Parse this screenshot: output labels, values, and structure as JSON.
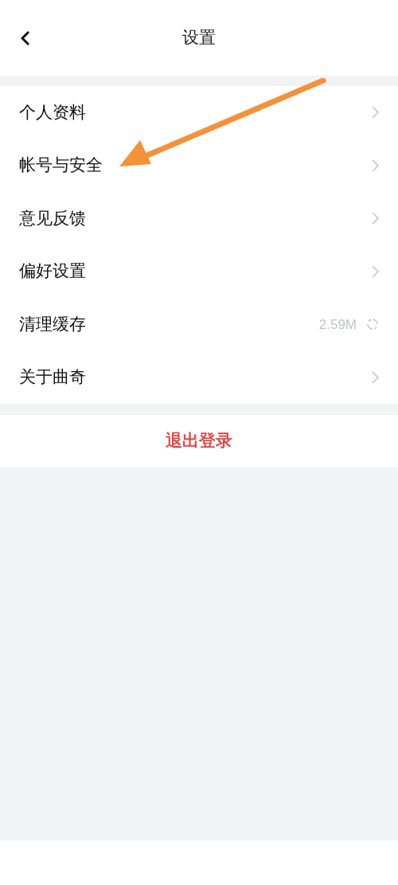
{
  "header": {
    "title": "设置"
  },
  "items": [
    {
      "label": "个人资料",
      "kind": "link"
    },
    {
      "label": "帐号与安全",
      "kind": "link"
    },
    {
      "label": "意见反馈",
      "kind": "link"
    },
    {
      "label": "偏好设置",
      "kind": "link"
    },
    {
      "label": "清理缓存",
      "kind": "cache",
      "value": "2.59M"
    },
    {
      "label": "关于曲奇",
      "kind": "link"
    }
  ],
  "logout": {
    "label": "退出登录"
  }
}
